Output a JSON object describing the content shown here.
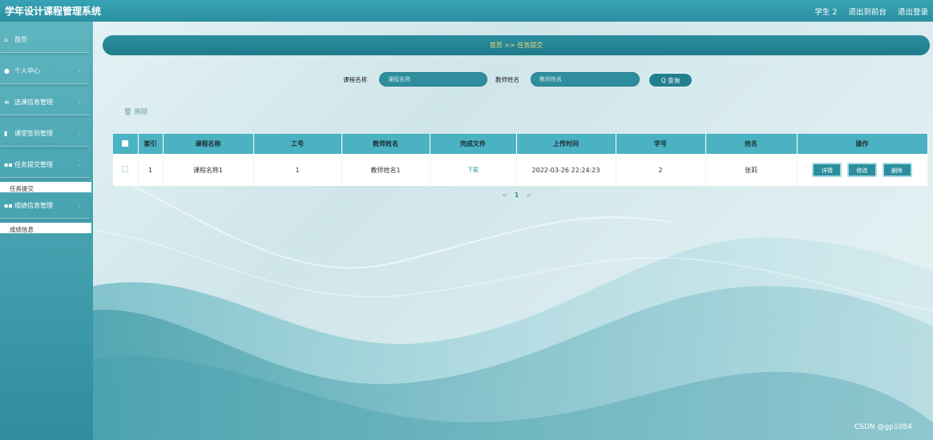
{
  "header": {
    "app_title": "学年设计课程管理系统",
    "links": [
      "学生 2",
      "退出到前台",
      "退出登录"
    ]
  },
  "sidebar": {
    "items": [
      {
        "label": "首页",
        "icon": "home-icon"
      },
      {
        "label": "个人中心",
        "icon": "user-icon"
      },
      {
        "label": "选课信息管理",
        "icon": "list-icon"
      },
      {
        "label": "课堂签到管理",
        "icon": "bookmark-icon"
      },
      {
        "label": "任务提交管理",
        "icon": "grid-icon"
      },
      {
        "label": "成绩信息管理",
        "icon": "grid-icon"
      }
    ],
    "submenus": [
      "任务提交",
      "成绩信息"
    ]
  },
  "breadcrumb": "首页 >> 任务提交",
  "search": {
    "course_label": "课程名称",
    "course_placeholder": "课程名称",
    "teacher_label": "教师姓名",
    "teacher_placeholder": "教师姓名",
    "query_button": "Q 查询"
  },
  "toolbar": {
    "delete_label": "删除"
  },
  "table": {
    "headers": [
      "索引",
      "课程名称",
      "工号",
      "教师姓名",
      "完成文件",
      "上传时间",
      "学号",
      "姓名",
      "操作"
    ],
    "rows": [
      {
        "index": "1",
        "course": "课程名称1",
        "staff_id": "1",
        "teacher": "教师姓名1",
        "file": "下载",
        "upload_time": "2022-03-26 22:24:23",
        "student_id": "2",
        "name": "张莉",
        "actions": [
          "详情",
          "修改",
          "删除"
        ]
      }
    ]
  },
  "pagination": {
    "prev": "<",
    "current": "1",
    "next": ">"
  },
  "watermark": "CSDN @gp1084",
  "colors": {
    "primary": "#2b8e9e",
    "header_row": "#4bb2c3",
    "accent_text": "#f4d67a"
  }
}
